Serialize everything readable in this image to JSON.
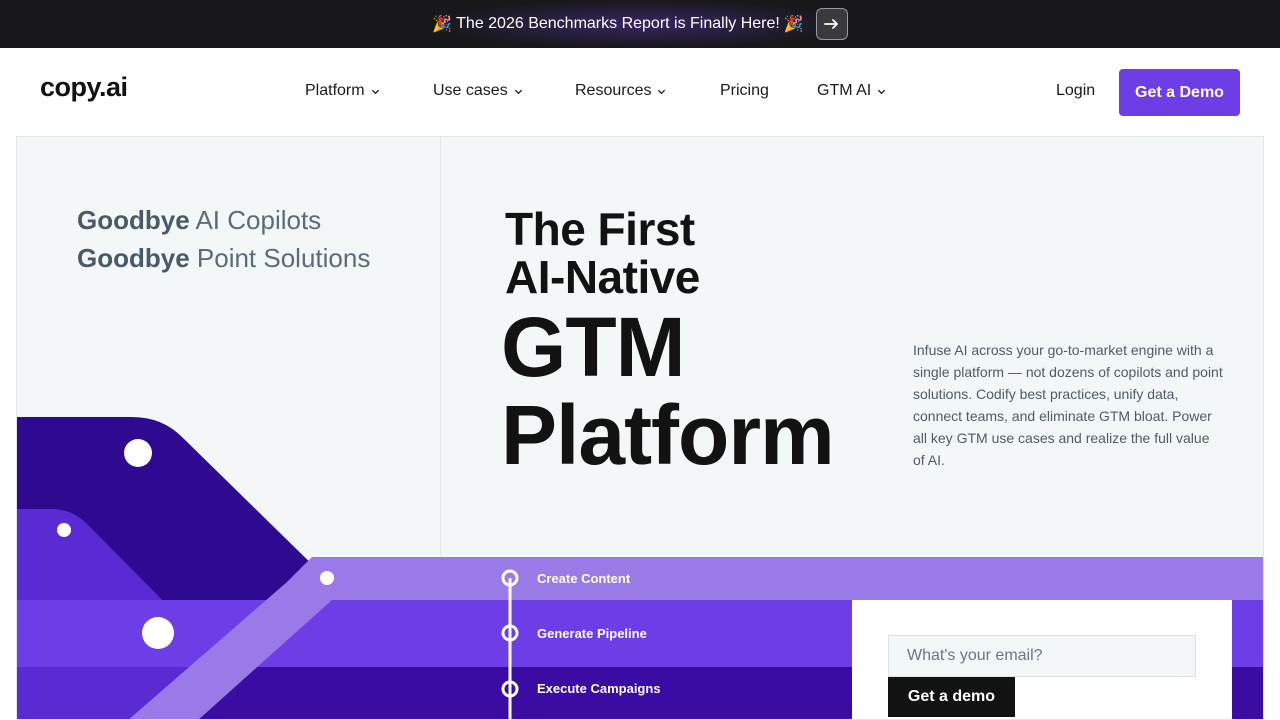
{
  "announcement": {
    "emoji_left": "🎉",
    "text": "The 2026 Benchmarks Report is Finally Here!",
    "emoji_right": "🎉",
    "arrow_icon": "arrow-right-icon"
  },
  "nav": {
    "logo": "copy.ai",
    "items": [
      {
        "label": "Platform",
        "has_dropdown": true
      },
      {
        "label": "Use cases",
        "has_dropdown": true
      },
      {
        "label": "Resources",
        "has_dropdown": true
      },
      {
        "label": "Pricing",
        "has_dropdown": false
      },
      {
        "label": "GTM AI",
        "has_dropdown": true
      }
    ],
    "login": "Login",
    "cta": "Get a Demo"
  },
  "hero": {
    "goodbye_lines": [
      {
        "bold": "Goodbye",
        "rest": " AI Copilots"
      },
      {
        "bold": "Goodbye",
        "rest": " Point Solutions"
      }
    ],
    "headline_small": [
      "The First",
      "AI-Native"
    ],
    "headline_big": [
      "GTM",
      "Platform"
    ],
    "description": "Infuse AI across your go-to-market engine with a single platform — not dozens of copilots and point solutions. Codify best practices, unify data, connect teams, and eliminate GTM bloat. Power all key GTM use cases and realize the full value of AI.",
    "steps": [
      "Create Content",
      "Generate Pipeline",
      "Execute Campaigns"
    ],
    "email_placeholder": "What's your email?",
    "form_button": "Get a demo"
  },
  "colors": {
    "accent": "#6d3ee6",
    "dark_purple": "#3a0ca3",
    "light_purple": "#9a7ae6",
    "background": "#f4f7f8"
  }
}
